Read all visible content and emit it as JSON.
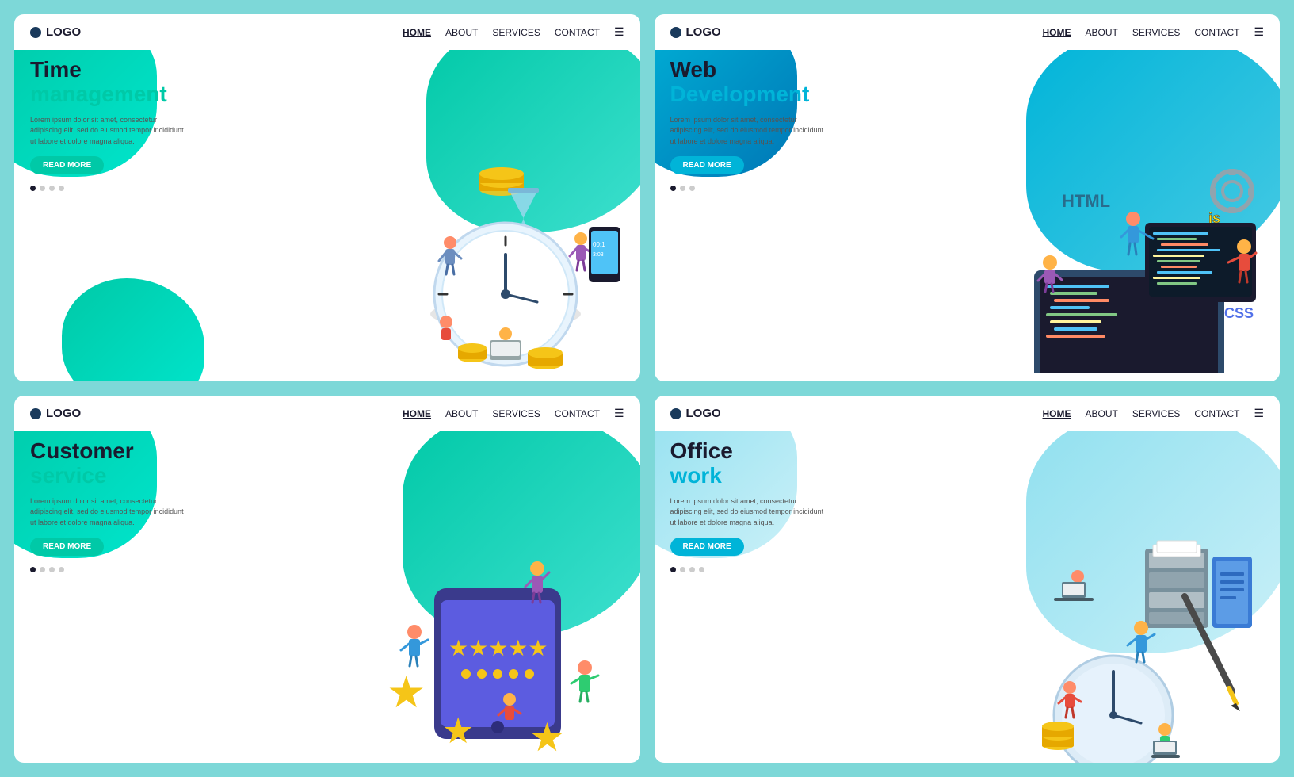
{
  "cards": [
    {
      "id": "time-management",
      "title_line1": "Time",
      "title_line2": "management",
      "title_color": "teal",
      "description": "Lorem ipsum dolor sit amet, consectetur adipiscing elit, sed do eiusmod tempor incididunt ut labore et dolore magna aliqua.",
      "btn_label": "READ MORE",
      "nav": {
        "logo": "LOGO",
        "links": [
          "HOME",
          "ABOUT",
          "SERVICES",
          "CONTACT"
        ]
      }
    },
    {
      "id": "web-development",
      "title_line1": "Web",
      "title_line2": "Development",
      "title_color": "blue",
      "description": "Lorem ipsum dolor sit amet, consectetur adipiscing elit, sed do eiusmod tempor incididunt ut labore et dolore magna aliqua.",
      "btn_label": "READ MORE",
      "nav": {
        "logo": "LOGO",
        "links": [
          "HOME",
          "ABOUT",
          "SERVICES",
          "CONTACT"
        ]
      }
    },
    {
      "id": "customer-service",
      "title_line1": "Customer",
      "title_line2": "service",
      "title_color": "teal",
      "description": "Lorem ipsum dolor sit amet, consectetur adipiscing elit, sed do eiusmod tempor incididunt ut labore et dolore magna aliqua.",
      "btn_label": "READ MORE",
      "nav": {
        "logo": "LOGO",
        "links": [
          "HOME",
          "ABOUT",
          "SERVICES",
          "CONTACT"
        ]
      }
    },
    {
      "id": "office-work",
      "title_line1": "Office",
      "title_line2": "work",
      "title_color": "blue",
      "description": "Lorem ipsum dolor sit amet, consectetur adipiscing elit, sed do eiusmod tempor incididunt ut labore et dolore magna aliqua.",
      "btn_label": "READ MORE",
      "nav": {
        "logo": "LOGO",
        "links": [
          "HOME",
          "ABOUT",
          "SERVICES",
          "CONTACT"
        ]
      }
    }
  ]
}
